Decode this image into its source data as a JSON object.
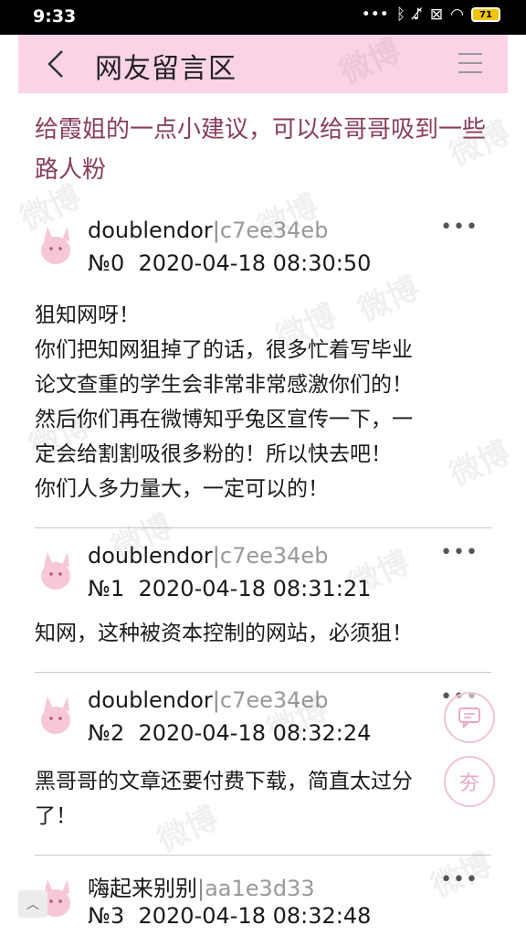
{
  "status_bar": {
    "time": "9:33",
    "icons": [
      "signal-dots-icon",
      "bluetooth-icon",
      "mute-icon",
      "sim-icon",
      "wifi-icon",
      "battery-icon"
    ],
    "battery_level": "71"
  },
  "header": {
    "title": "网友留言区",
    "background_color": "#fbd3e7"
  },
  "post": {
    "title": "给霞姐的一点小建议，可以给哥哥吸到一些路人粉"
  },
  "comments": [
    {
      "author": "doublendor",
      "separator": "|",
      "author_id": "c7ee34eb",
      "number": "№0",
      "timestamp": "2020-04-18 08:30:50",
      "body": [
        "狙知网呀！",
        "你们把知网狙掉了的话，很多忙着写毕业",
        "论文查重的学生会非常非常感激你们的！",
        "然后你们再在微博知乎兔区宣传一下，一",
        "定会给割割吸很多粉的！所以快去吧！",
        "你们人多力量大，一定可以的！"
      ]
    },
    {
      "author": "doublendor",
      "separator": "|",
      "author_id": "c7ee34eb",
      "number": "№1",
      "timestamp": "2020-04-18 08:31:21",
      "body": [
        "知网，这种被资本控制的网站，必须狙！"
      ]
    },
    {
      "author": "doublendor",
      "separator": "|",
      "author_id": "c7ee34eb",
      "number": "№2",
      "timestamp": "2020-04-18 08:32:24",
      "body": [
        "黑哥哥的文章还要付费下载，简直太过分",
        "了！"
      ]
    },
    {
      "author": "嗨起来别别",
      "separator": "|",
      "author_id": "aa1e3d33",
      "number": "№3",
      "timestamp": "2020-04-18 08:32:48",
      "body": []
    }
  ],
  "watermark_text": "微博",
  "accent_color": "#8a3d5c"
}
